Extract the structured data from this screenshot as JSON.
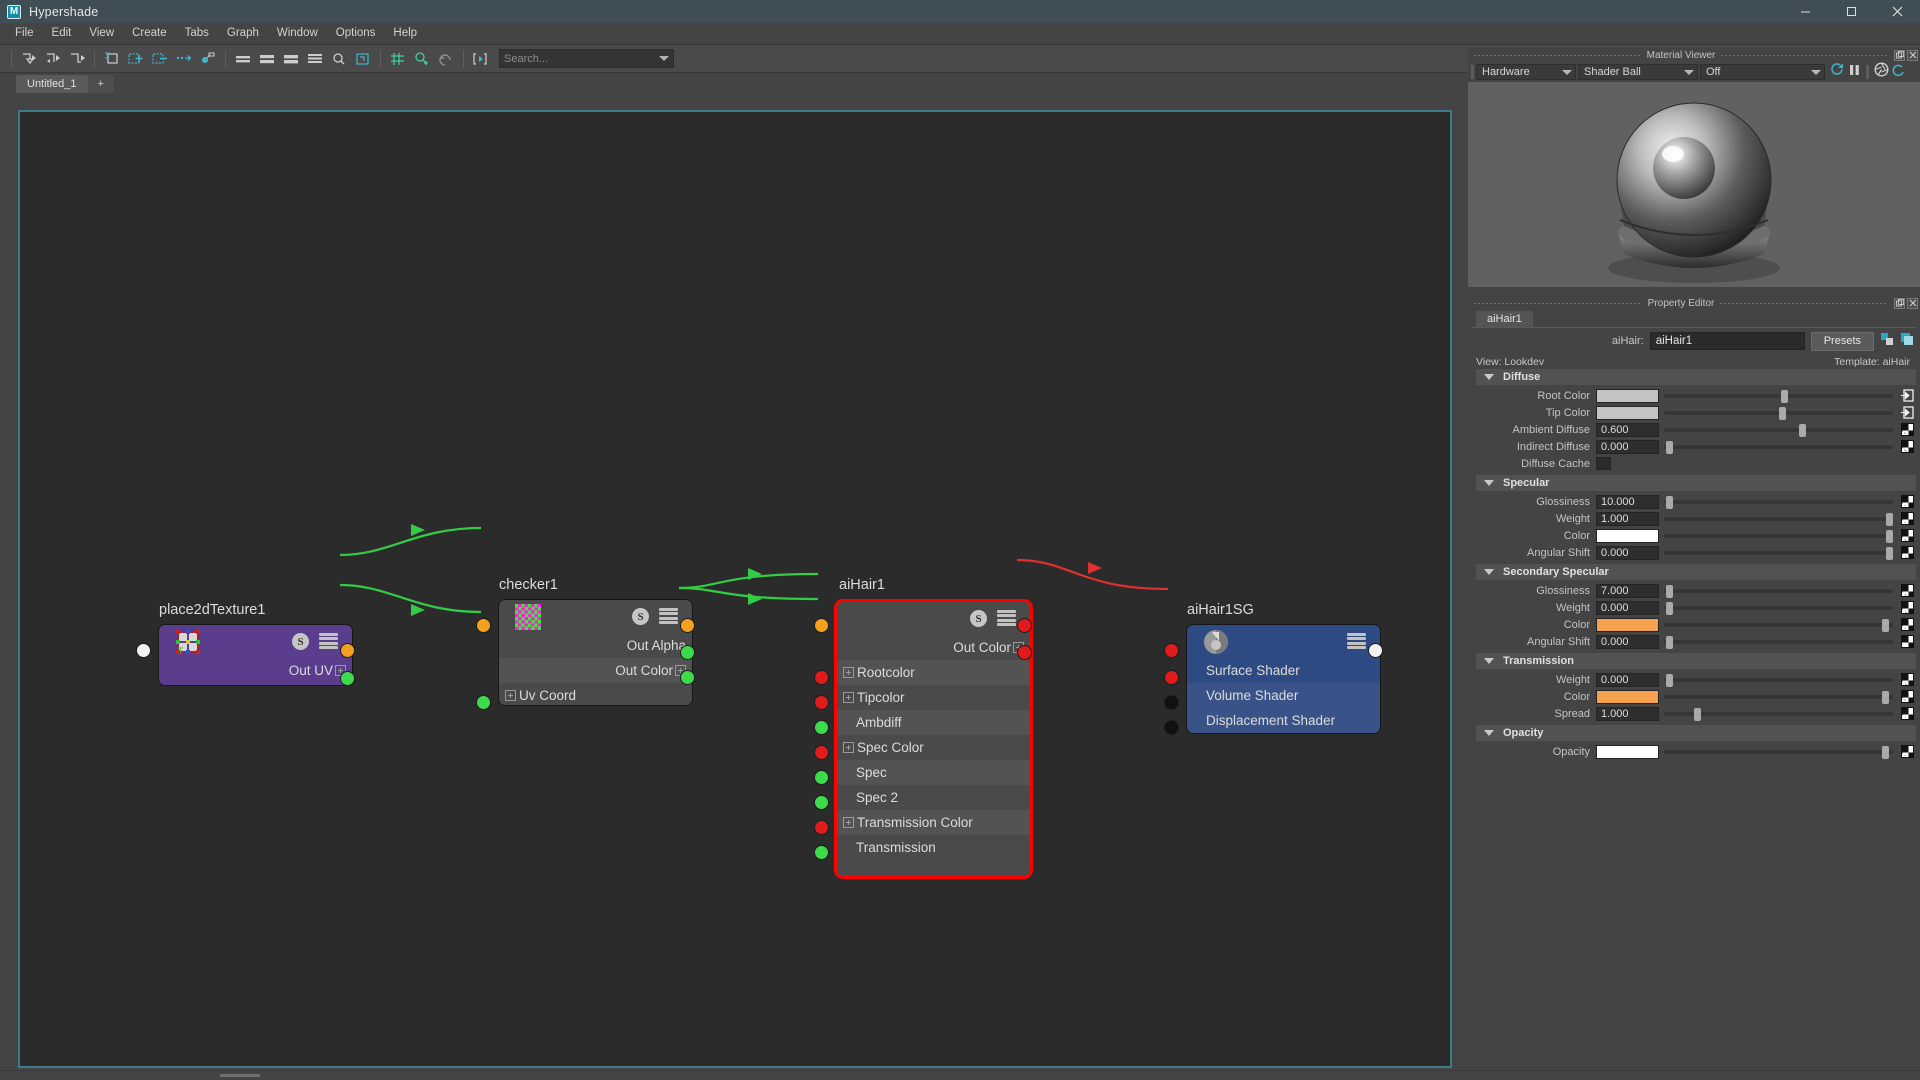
{
  "window": {
    "title": "Hypershade",
    "logo_icon": "maya-logo-icon",
    "minimize_icon": "minimize-icon",
    "maximize_icon": "maximize-icon",
    "close_icon": "close-icon"
  },
  "menubar": {
    "items": [
      {
        "label": "File"
      },
      {
        "label": "Edit"
      },
      {
        "label": "View"
      },
      {
        "label": "Create"
      },
      {
        "label": "Tabs"
      },
      {
        "label": "Graph"
      },
      {
        "label": "Window"
      },
      {
        "label": "Options"
      },
      {
        "label": "Help"
      }
    ]
  },
  "toolbar": {
    "buttons": [
      {
        "name": "graph-input-connections-icon"
      },
      {
        "name": "graph-input-output-connections-icon"
      },
      {
        "name": "graph-output-connections-icon"
      },
      {
        "name": "rearrange-graph-icon"
      },
      {
        "name": "add-selected-to-graph-icon"
      },
      {
        "name": "remove-selected-from-graph-icon"
      },
      {
        "name": "clear-graph-icon"
      },
      {
        "name": "show-upstream-icon"
      },
      {
        "name": "show-small-node-swatch-icon"
      },
      {
        "name": "show-medium-node-swatch-icon"
      },
      {
        "name": "show-large-node-swatch-icon"
      },
      {
        "name": "show-connected-attributes-icon"
      },
      {
        "name": "show-all-attributes-icon"
      },
      {
        "name": "frame-all-icon"
      },
      {
        "name": "toggle-grid-icon"
      },
      {
        "name": "create-node-icon"
      },
      {
        "name": "undo-view-icon"
      },
      {
        "name": "open-render-view-icon"
      }
    ],
    "search": {
      "icon": "search-filter-icon",
      "placeholder": "Search...",
      "value": ""
    }
  },
  "tabstrip": {
    "tabs": [
      {
        "label": "Untitled_1"
      }
    ],
    "add_label": "+"
  },
  "graph": {
    "nodes": [
      {
        "id": "place2dTexture1",
        "title": "place2dTexture1",
        "color": "#5b3d8e",
        "selected": false,
        "icon": "place2d-texture-icon",
        "badge_s": "S",
        "menu_icon": "node-menu-icon",
        "left_ports": [
          {
            "color": "white",
            "label": ""
          }
        ],
        "right_ports": [
          {
            "color": "orange",
            "label": ""
          }
        ],
        "rows": [
          {
            "label": "Out UV",
            "side": "right",
            "port": "green",
            "expandable": true
          }
        ]
      },
      {
        "id": "checker1",
        "title": "checker1",
        "color": "#4a4a4a",
        "selected": false,
        "icon": "checker-swatch-icon",
        "badge_s": "S",
        "menu_icon": "node-menu-icon",
        "left_ports": [
          {
            "color": "orange",
            "label": ""
          }
        ],
        "right_ports": [
          {
            "color": "orange",
            "label": ""
          }
        ],
        "rows": [
          {
            "label": "Out Alpha",
            "side": "right",
            "port": "green",
            "expandable": false
          },
          {
            "label": "Out Color",
            "side": "right",
            "port": "green",
            "expandable": true
          },
          {
            "label": "Uv Coord",
            "side": "left",
            "port": "green",
            "expandable": true
          }
        ]
      },
      {
        "id": "aiHair1",
        "title": "aiHair1",
        "color": "#4a4a4a",
        "selected": true,
        "selection_color": "#ff0000",
        "badge_s": "S",
        "menu_icon": "node-menu-icon",
        "left_ports": [
          {
            "color": "orange",
            "label": ""
          }
        ],
        "right_ports": [
          {
            "color": "red",
            "label": ""
          }
        ],
        "rows": [
          {
            "label": "Out Color",
            "side": "right",
            "port": "red",
            "expandable": true
          },
          {
            "label": "Rootcolor",
            "side": "left",
            "port": "red",
            "expandable": true
          },
          {
            "label": "Tipcolor",
            "side": "left",
            "port": "red",
            "expandable": true
          },
          {
            "label": "Ambdiff",
            "side": "left",
            "port": "green",
            "expandable": false
          },
          {
            "label": "Spec Color",
            "side": "left",
            "port": "red",
            "expandable": true
          },
          {
            "label": "Spec",
            "side": "left",
            "port": "green",
            "expandable": false
          },
          {
            "label": "Spec 2",
            "side": "left",
            "port": "green",
            "expandable": false
          },
          {
            "label": "Transmission Color",
            "side": "left",
            "port": "red",
            "expandable": true
          },
          {
            "label": "Transmission",
            "side": "left",
            "port": "green",
            "expandable": false
          }
        ]
      },
      {
        "id": "aiHair1SG",
        "title": "aiHair1SG",
        "color": "#2e4a82",
        "selected": false,
        "icon": "shading-group-icon",
        "menu_icon": "node-menu-icon",
        "left_ports": [
          {
            "color": "red",
            "label": ""
          }
        ],
        "right_ports": [
          {
            "color": "white",
            "label": ""
          }
        ],
        "rows": [
          {
            "label": "Surface Shader",
            "side": "left",
            "port": "red",
            "expandable": false
          },
          {
            "label": "Volume Shader",
            "side": "left",
            "port": "black",
            "expandable": false
          },
          {
            "label": "Displacement Shader",
            "side": "left",
            "port": "black",
            "expandable": false
          }
        ]
      }
    ],
    "connection_colors": {
      "value": "#33cc44",
      "shader": "#e03030"
    }
  },
  "material_viewer": {
    "panel_title": "Material Viewer",
    "undock_icon": "undock-icon",
    "close_icon": "close-icon",
    "renderer": {
      "value": "Hardware",
      "caret": "chevron-down-icon"
    },
    "geometry": {
      "value": "Shader Ball",
      "caret": "chevron-down-icon"
    },
    "lighting": {
      "value": "Off",
      "caret": "chevron-down-icon"
    },
    "refresh_icon": "auto-refresh-icon",
    "pause_icon": "pause-icon",
    "reload_icon": "reload-icon",
    "aperture_icon": "aperture-icon",
    "preview_name": "shader-ball-preview"
  },
  "property_editor": {
    "panel_title": "Property Editor",
    "undock_icon": "undock-icon",
    "close_icon": "close-icon",
    "tab": "aiHair1",
    "node_type_label": "aiHair:",
    "node_name_value": "aiHair1",
    "presets_label": "Presets",
    "copy_tab_icon": "copy-tab-icon",
    "show-hide-icon": "show-hide-icon",
    "view_label": "View: Lookdev",
    "template_label": "Template: aiHair",
    "sections": [
      {
        "title": "Diffuse",
        "collapse_icon": "chevron-down-icon",
        "rows": [
          {
            "label": "Root Color",
            "type": "color",
            "color": "#c3c3c3",
            "slider": 0.52,
            "map": "connect-icon"
          },
          {
            "label": "Tip Color",
            "type": "color",
            "color": "#c3c3c3",
            "slider": 0.5,
            "map": "connect-icon"
          },
          {
            "label": "Ambient Diffuse",
            "type": "value",
            "value": "0.600",
            "slider": 0.59,
            "map": "checker-map-icon"
          },
          {
            "label": "Indirect Diffuse",
            "type": "value",
            "value": "0.000",
            "slider": 0.01,
            "map": "checker-map-icon"
          },
          {
            "label": "Diffuse Cache",
            "type": "checkbox",
            "checked": false
          }
        ]
      },
      {
        "title": "Specular",
        "collapse_icon": "chevron-down-icon",
        "rows": [
          {
            "label": "Glossiness",
            "type": "value",
            "value": "10.000",
            "slider": 0.02,
            "map": "checker-map-icon"
          },
          {
            "label": "Weight",
            "type": "value",
            "value": "1.000",
            "slider": 0.97,
            "map": "checker-map-icon"
          },
          {
            "label": "Color",
            "type": "color",
            "color": "#ffffff",
            "slider": 0.97,
            "map": "checker-map-icon"
          },
          {
            "label": "Angular Shift",
            "type": "value",
            "value": "0.000",
            "slider": 0.97,
            "map": "checker-map-icon"
          }
        ]
      },
      {
        "title": "Secondary Specular",
        "collapse_icon": "chevron-down-icon",
        "rows": [
          {
            "label": "Glossiness",
            "type": "value",
            "value": "7.000",
            "slider": 0.02,
            "map": "checker-map-icon"
          },
          {
            "label": "Weight",
            "type": "value",
            "value": "0.000",
            "slider": 0.02,
            "map": "checker-map-icon"
          },
          {
            "label": "Color",
            "type": "color",
            "color": "#f9a košice",
            "slider": 0.95,
            "map": "checker-map-icon"
          },
          {
            "label": "Angular Shift",
            "type": "value",
            "value": "0.000",
            "slider": 0.02,
            "map": "checker-map-icon"
          }
        ]
      },
      {
        "title": "Transmission",
        "collapse_icon": "chevron-down-icon",
        "rows": [
          {
            "label": "Weight",
            "type": "value",
            "value": "0.000",
            "slider": 0.02,
            "map": "checker-map-icon"
          },
          {
            "label": "Color",
            "type": "color",
            "color": "#f7a24f",
            "slider": 0.95,
            "map": "checker-map-icon"
          },
          {
            "label": "Spread",
            "type": "value",
            "value": "1.000",
            "slider": 0.13,
            "map": "checker-map-icon"
          }
        ]
      },
      {
        "title": "Opacity",
        "collapse_icon": "chevron-down-icon",
        "rows": [
          {
            "label": "Opacity",
            "type": "color",
            "color": "#ffffff",
            "slider": 0.95,
            "map": "checker-map-icon"
          }
        ]
      }
    ]
  }
}
